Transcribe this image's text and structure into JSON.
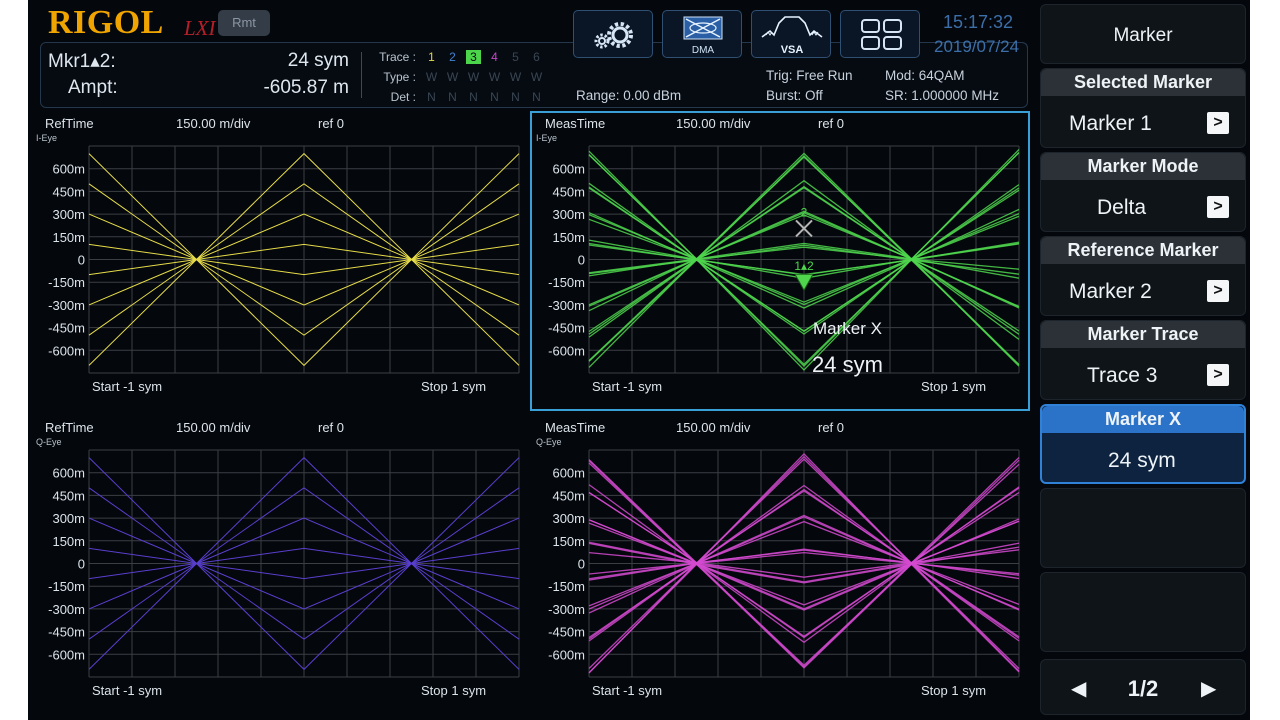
{
  "header": {
    "logo": "RIGOL",
    "lxi": "LXI",
    "rmt": "Rmt",
    "marker_label": "Mkr1▴2:",
    "marker_value": "24 sym",
    "ampt_label": "Ampt:",
    "ampt_value": "-605.87 m",
    "trace_label": "Trace :",
    "type_label": "Type :",
    "det_label": "Det :",
    "traces": [
      "1",
      "2",
      "3",
      "4",
      "5",
      "6"
    ],
    "trace_colors": [
      "#e3d64a",
      "#3f83d1",
      "#4cd54a",
      "#c447c4",
      "#3a4653",
      "#3a4653"
    ],
    "active_trace": "3",
    "types": [
      "W",
      "W",
      "W",
      "W",
      "W",
      "W"
    ],
    "dets": [
      "N",
      "N",
      "N",
      "N",
      "N",
      "N"
    ],
    "range": "Range: 0.00 dBm",
    "trig": "Trig: Free Run",
    "burst": "Burst: Off",
    "mod": "Mod: 64QAM",
    "sr": "SR: 1.000000 MHz",
    "time": "15:17:32",
    "date": "2019/07/24",
    "icons": [
      "settings-gears",
      "DMA",
      "VSA",
      "layout-grid"
    ]
  },
  "plots": [
    {
      "mode": "RefTime",
      "sub": "I-Eye",
      "scale": "150.00 m/div",
      "ref": "ref 0",
      "start": "Start -1 sym",
      "stop": "Stop 1 sym",
      "color": "#e6dc4a",
      "selected": false
    },
    {
      "mode": "MeasTime",
      "sub": "I-Eye",
      "scale": "150.00 m/div",
      "ref": "ref 0",
      "start": "Start -1 sym",
      "stop": "Stop 1 sym",
      "color": "#4fd64d",
      "selected": true
    },
    {
      "mode": "RefTime",
      "sub": "Q-Eye",
      "scale": "150.00 m/div",
      "ref": "ref 0",
      "start": "Start -1 sym",
      "stop": "Stop 1 sym",
      "color": "#5a3fcf",
      "selected": false
    },
    {
      "mode": "MeasTime",
      "sub": "Q-Eye",
      "scale": "150.00 m/div",
      "ref": "ref 0",
      "start": "Start -1 sym",
      "stop": "Stop 1 sym",
      "color": "#d34ad0",
      "selected": false
    }
  ],
  "y_ticks": [
    "600m",
    "450m",
    "300m",
    "150m",
    "0",
    "-150m",
    "-300m",
    "-450m",
    "-600m"
  ],
  "marker_overlay": {
    "marker2_label": "2",
    "delta_label": "1▴2",
    "title": "Marker X",
    "value": "24 sym"
  },
  "menu": {
    "title": "Marker",
    "items": [
      {
        "label": "Selected Marker",
        "value": "Marker 1"
      },
      {
        "label": "Marker Mode",
        "value": "Delta"
      },
      {
        "label": "Reference Marker",
        "value": "Marker 2"
      },
      {
        "label": "Marker Trace",
        "value": "Trace 3"
      }
    ],
    "marker_x": {
      "label": "Marker X",
      "value": "24 sym"
    },
    "page": "1/2"
  }
}
